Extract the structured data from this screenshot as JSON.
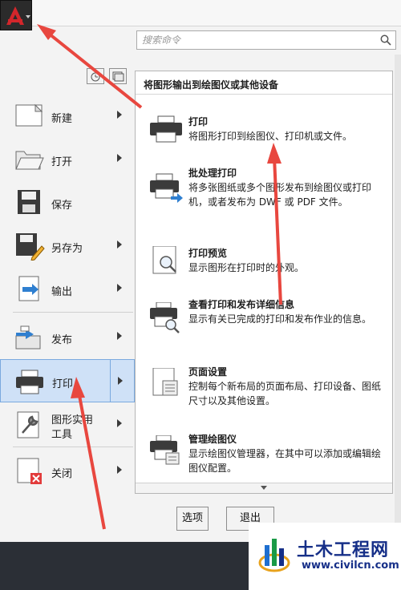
{
  "app_button": {
    "icon": "autocad-logo-icon"
  },
  "search": {
    "placeholder": "搜索命令"
  },
  "left_menu": [
    {
      "label": "新建",
      "icon": "new-doc-icon"
    },
    {
      "label": "打开",
      "icon": "open-folder-icon"
    },
    {
      "label": "保存",
      "icon": "save-icon"
    },
    {
      "label": "另存为",
      "icon": "save-as-icon"
    },
    {
      "label": "输出",
      "icon": "export-icon"
    },
    {
      "label": "发布",
      "icon": "publish-icon"
    },
    {
      "label": "打印",
      "icon": "printer-icon",
      "selected": true
    },
    {
      "label_line1": "图形实用",
      "label_line2": "工具",
      "icon": "drawing-utilities-icon"
    },
    {
      "label": "关闭",
      "icon": "close-doc-icon"
    }
  ],
  "submenu": {
    "title": "将图形输出到绘图仪或其他设备",
    "items": [
      {
        "title": "打印",
        "desc": "将图形打印到绘图仪、打印机或文件。"
      },
      {
        "title": "批处理打印",
        "desc": "将多张图纸或多个图形发布到绘图仪或打印机，或者发布为 DWF 或 PDF 文件。"
      },
      {
        "title": "打印预览",
        "desc": "显示图形在打印时的外观。"
      },
      {
        "title": "查看打印和发布详细信息",
        "desc": "显示有关已完成的打印和发布作业的信息。"
      },
      {
        "title": "页面设置",
        "desc": "控制每个新布局的页面布局、打印设备、图纸尺寸以及其他设置。"
      },
      {
        "title": "管理绘图仪",
        "desc": "显示绘图仪管理器，在其中可以添加或编辑绘图仪配置。"
      }
    ]
  },
  "buttons": {
    "options": "选项",
    "exit": "退出"
  },
  "watermark": {
    "title": "土木工程网",
    "url": "www.civilcn.com"
  },
  "colors": {
    "annotation_arrow": "#e8473f",
    "selected_bg": "#cfe1f7",
    "selected_border": "#7aa9df"
  }
}
